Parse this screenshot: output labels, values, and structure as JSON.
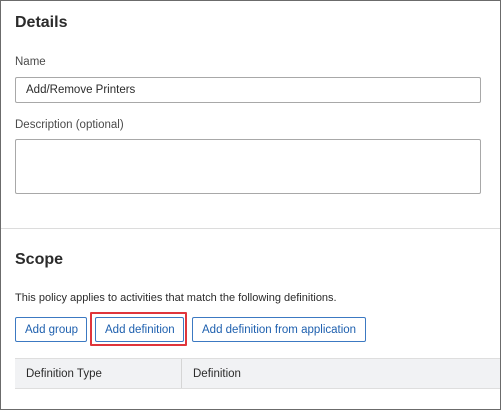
{
  "details": {
    "title": "Details",
    "name_label": "Name",
    "name_value": "Add/Remove Printers",
    "description_label": "Description (optional)",
    "description_value": ""
  },
  "scope": {
    "title": "Scope",
    "description": "This policy applies to activities that match the following definitions.",
    "buttons": {
      "add_group": "Add group",
      "add_definition": "Add definition",
      "add_definition_from_application": "Add definition from application"
    },
    "highlighted_button": "add_definition",
    "highlight_color": "#e0353b",
    "table": {
      "columns": [
        "Definition Type",
        "Definition"
      ],
      "rows": []
    }
  },
  "colors": {
    "button_border": "#3c79c2",
    "button_text": "#1d5fae",
    "table_header_bg": "#f1f2f4"
  }
}
